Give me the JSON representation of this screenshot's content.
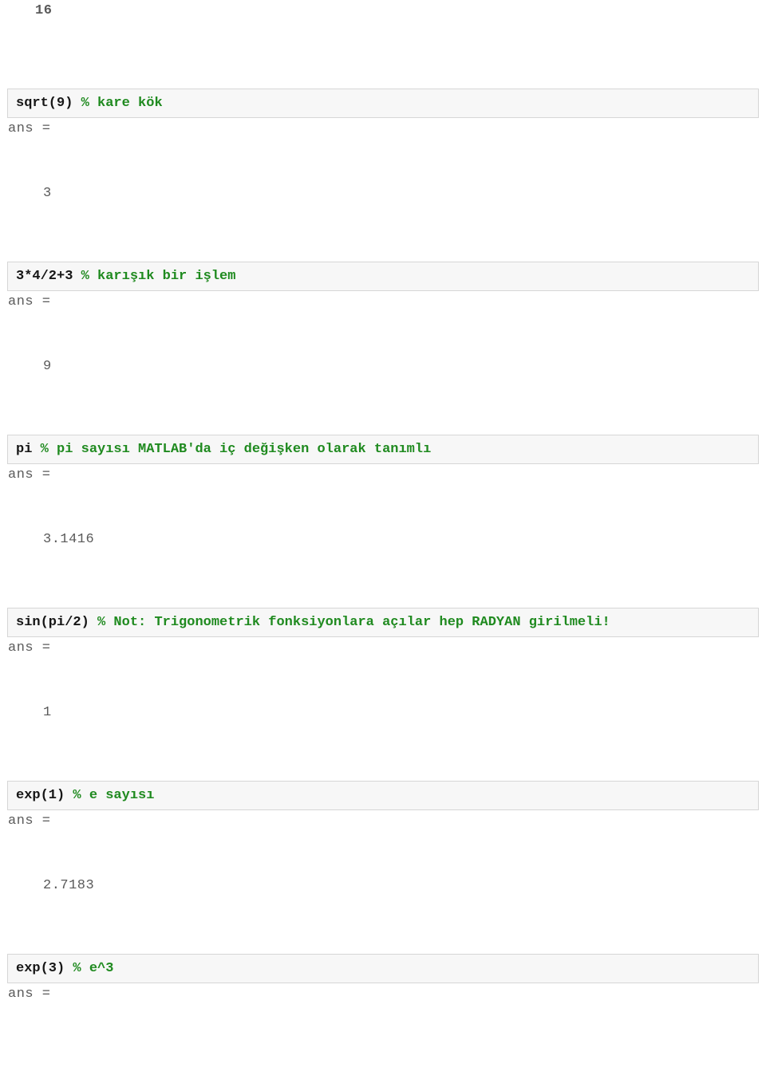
{
  "top_output_value": "16",
  "blocks": [
    {
      "code_cmd": "sqrt(9)",
      "code_comment": "% kare kök",
      "ans_label": "ans =",
      "ans_value": "3"
    },
    {
      "code_cmd": "3*4/2+3",
      "code_comment": "% karışık bir işlem",
      "ans_label": "ans =",
      "ans_value": "9"
    },
    {
      "code_cmd": "pi",
      "code_comment": "% pi sayısı MATLAB'da iç değişken olarak tanımlı",
      "ans_label": "ans =",
      "ans_value": "3.1416"
    },
    {
      "code_cmd": "sin(pi/2)",
      "code_comment": "% Not: Trigonometrik fonksiyonlara açılar hep RADYAN girilmeli!",
      "ans_label": "ans =",
      "ans_value": "1"
    },
    {
      "code_cmd": "exp(1)",
      "code_comment": "% e sayısı",
      "ans_label": "ans =",
      "ans_value": "2.7183"
    },
    {
      "code_cmd": "exp(3)",
      "code_comment": "% e^3",
      "ans_label": "ans =",
      "ans_value": ""
    }
  ]
}
